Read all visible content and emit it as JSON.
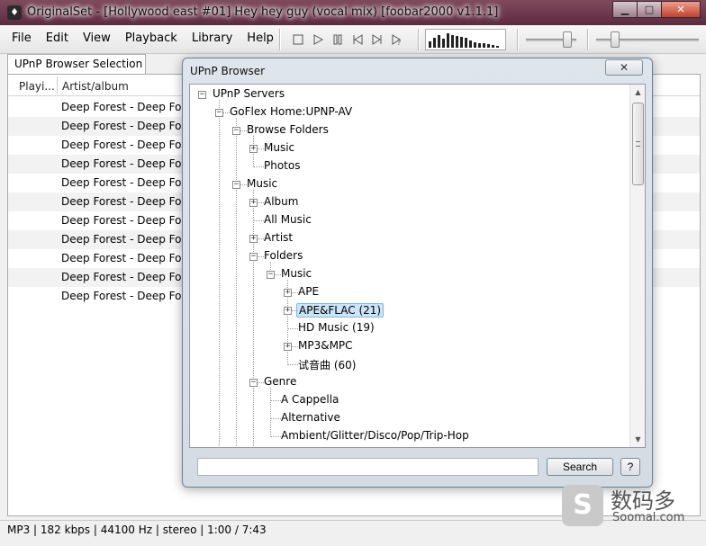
{
  "window": {
    "title": "OriginalSet - [Hollywood east #01] Hey hey guy (vocal mix)   [foobar2000 v1.1.1]",
    "controls": [
      "minimize",
      "maximize",
      "close"
    ]
  },
  "menu": [
    {
      "label": "File"
    },
    {
      "label": "Edit"
    },
    {
      "label": "View"
    },
    {
      "label": "Playback"
    },
    {
      "label": "Library"
    },
    {
      "label": "Help"
    }
  ],
  "transport_icons": [
    "stop-icon",
    "play-icon",
    "pause-icon",
    "previous-icon",
    "next-icon",
    "random-icon"
  ],
  "visualizer_levels": [
    0.4,
    0.6,
    0.8,
    0.55,
    0.9,
    0.75,
    0.7,
    0.65,
    0.6,
    0.45,
    0.35,
    0.25,
    0.3,
    0.2,
    0.15,
    0.1
  ],
  "volume_level": 0.9,
  "seek_position": 0.15,
  "tab": {
    "label": "UPnP Browser Selection"
  },
  "playlist": {
    "columns": [
      "Playi...",
      "Artist/album"
    ],
    "rows": [
      "Deep Forest - Deep Forest",
      "Deep Forest - Deep Forest",
      "Deep Forest - Deep Forest",
      "Deep Forest - Deep Forest",
      "Deep Forest - Deep Forest",
      "Deep Forest - Deep Forest",
      "Deep Forest - Deep Forest",
      "Deep Forest - Deep Forest",
      "Deep Forest - Deep Forest",
      "Deep Forest - Deep Forest",
      "Deep Forest - Deep Forest"
    ]
  },
  "status": {
    "text": "MP3 | 182 kbps | 44100 Hz | stereo | 1:00 / 7:43"
  },
  "dialog": {
    "title": "UPnP Browser",
    "close_label": "✕",
    "tree": [
      {
        "label": "UPnP Servers",
        "depth": 0,
        "exp": "-"
      },
      {
        "label": "GoFlex Home:UPNP-AV",
        "depth": 1,
        "exp": "-"
      },
      {
        "label": "Browse Folders",
        "depth": 2,
        "exp": "-"
      },
      {
        "label": "Music",
        "depth": 3,
        "exp": "+"
      },
      {
        "label": "Photos",
        "depth": 3,
        "exp": ""
      },
      {
        "label": "Music",
        "depth": 2,
        "exp": "-"
      },
      {
        "label": "Album",
        "depth": 3,
        "exp": "+"
      },
      {
        "label": "All Music",
        "depth": 3,
        "exp": ""
      },
      {
        "label": "Artist",
        "depth": 3,
        "exp": "+"
      },
      {
        "label": "Folders",
        "depth": 3,
        "exp": "-"
      },
      {
        "label": "Music",
        "depth": 4,
        "exp": "-"
      },
      {
        "label": "APE",
        "depth": 5,
        "exp": "+"
      },
      {
        "label": "APE&FLAC (21)",
        "depth": 5,
        "exp": "+",
        "selected": true
      },
      {
        "label": "HD Music (19)",
        "depth": 5,
        "exp": ""
      },
      {
        "label": "MP3&MPC",
        "depth": 5,
        "exp": "+"
      },
      {
        "label": "试音曲 (60)",
        "depth": 5,
        "exp": ""
      },
      {
        "label": "Genre",
        "depth": 3,
        "exp": "-"
      },
      {
        "label": "A Cappella",
        "depth": 4,
        "exp": ""
      },
      {
        "label": "Alternative",
        "depth": 4,
        "exp": ""
      },
      {
        "label": "Ambient/Glitter/Disco/Pop/Trip-Hop",
        "depth": 4,
        "exp": ""
      }
    ],
    "search_value": "",
    "search_label": "Search",
    "help_label": "?"
  },
  "watermark": {
    "cn": "数码多",
    "en": "Soomal.com",
    "logo_letter": "S"
  }
}
